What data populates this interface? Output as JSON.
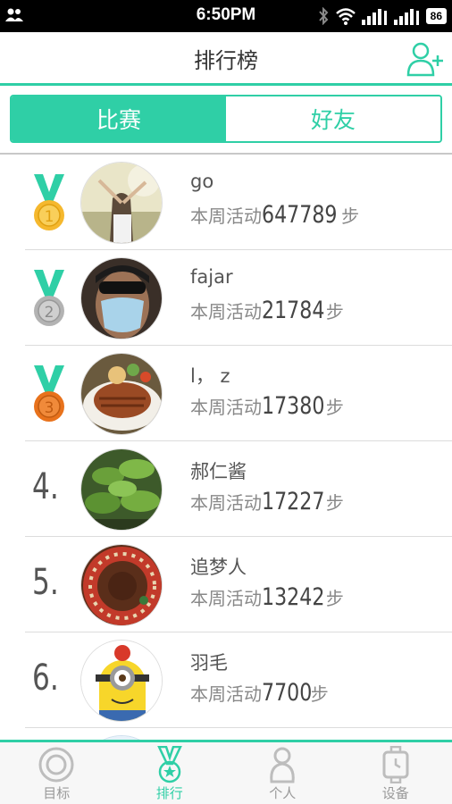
{
  "status_bar": {
    "time": "6:50PM",
    "battery": "86",
    "icons": [
      "contacts-icon",
      "bluetooth-icon",
      "wifi-icon",
      "signal-icon",
      "signal-icon",
      "battery-icon"
    ]
  },
  "header": {
    "title": "排行榜",
    "add_friend_icon": "add-user-icon"
  },
  "tabs": [
    {
      "label": "比赛",
      "active": true
    },
    {
      "label": "好友",
      "active": false
    }
  ],
  "leaderboard": {
    "activity_prefix": "本周活动",
    "steps_suffix": "步",
    "rows": [
      {
        "rank": "1",
        "medal": "gold-medal-icon",
        "name": "go",
        "steps": "647789"
      },
      {
        "rank": "2",
        "medal": "silver-medal-icon",
        "name": "fajar",
        "steps": "21784"
      },
      {
        "rank": "3",
        "medal": "bronze-medal-icon",
        "name": "l，  z",
        "steps": "17380"
      },
      {
        "rank": "4.",
        "name": "郝仁酱",
        "steps": "17227"
      },
      {
        "rank": "5.",
        "name": "追梦人",
        "steps": "13242"
      },
      {
        "rank": "6.",
        "name": "羽毛",
        "steps": "7700"
      }
    ]
  },
  "bottom_nav": [
    {
      "label": "目标",
      "icon": "target-icon",
      "active": false
    },
    {
      "label": "排行",
      "icon": "ranking-medal-icon",
      "active": true
    },
    {
      "label": "个人",
      "icon": "person-icon",
      "active": false
    },
    {
      "label": "设备",
      "icon": "watch-device-icon",
      "active": false
    }
  ],
  "colors": {
    "accent": "#2fcfa6",
    "gold": "#f5b82e",
    "silver": "#b3b3b3",
    "bronze": "#e8721c"
  }
}
